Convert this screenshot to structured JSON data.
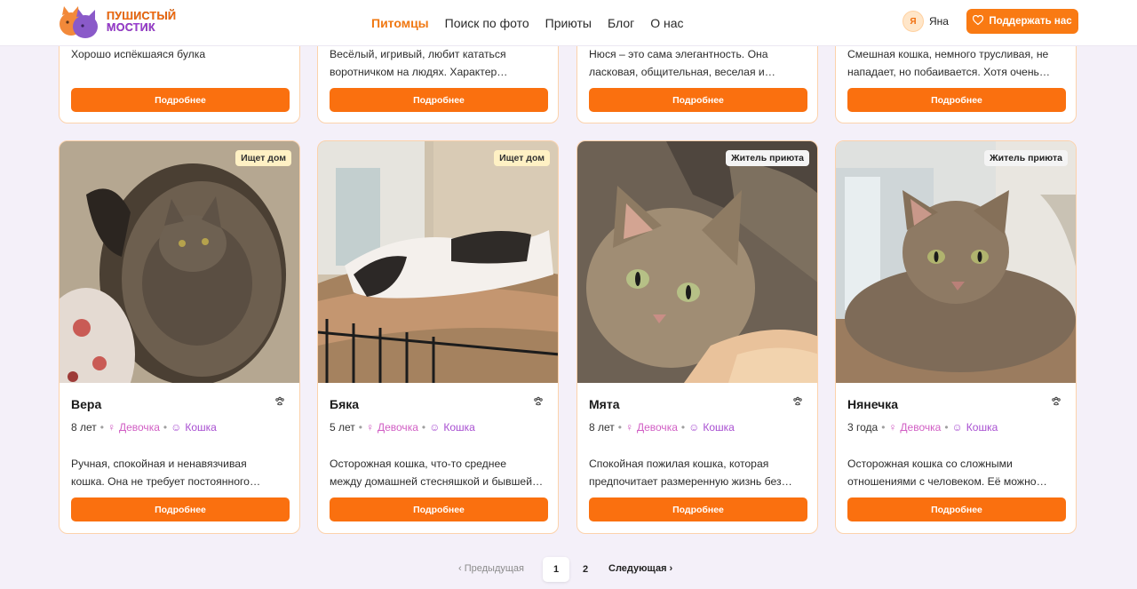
{
  "header": {
    "logo_line1": "ПУШИСТЫЙ",
    "logo_line2": "МОСТИК",
    "nav": [
      "Питомцы",
      "Поиск по фото",
      "Приюты",
      "Блог",
      "О нас"
    ],
    "user_initial": "Я",
    "user_name": "Яна",
    "donate_label": "Поддержать нас"
  },
  "top_cards": [
    {
      "desc1": "Хорошо испёкшаяся булка",
      "desc2": "",
      "button": "Подробнее"
    },
    {
      "desc1": "Весёлый, игривый, любит кататься",
      "desc2": "воротничком на людях. Характер…",
      "button": "Подробнее"
    },
    {
      "desc1": "Нюся – это сама элегантность. Она",
      "desc2": "ласковая, общительная, веселая и…",
      "button": "Подробнее"
    },
    {
      "desc1": "Смешная кошка, немного трусливая, не",
      "desc2": "нападает, но побаивается. Хотя очень…",
      "button": "Подробнее"
    }
  ],
  "cards": [
    {
      "badge": "Ищет дом",
      "name": "Вера",
      "age": "8 лет",
      "gender": "Девочка",
      "kind": "Кошка",
      "desc1": "Ручная, спокойная и ненавязчивая",
      "desc2": "кошка. Она не требует постоянного…",
      "button": "Подробнее"
    },
    {
      "badge": "Ищет дом",
      "name": "Бяка",
      "age": "5 лет",
      "gender": "Девочка",
      "kind": "Кошка",
      "desc1": "Осторожная кошка, что-то среднее",
      "desc2": "между домашней стесняшкой и бывшей…",
      "button": "Подробнее"
    },
    {
      "badge": "Житель приюта",
      "name": "Мята",
      "age": "8 лет",
      "gender": "Девочка",
      "kind": "Кошка",
      "desc1": "Спокойная пожилая кошка, которая",
      "desc2": "предпочитает размеренную жизнь без…",
      "button": "Подробнее"
    },
    {
      "badge": "Житель приюта",
      "name": "Нянечка",
      "age": "3 года",
      "gender": "Девочка",
      "kind": "Кошка",
      "desc1": "Осторожная кошка со сложными",
      "desc2": "отношениями с человеком. Её можно…",
      "button": "Подробнее"
    }
  ],
  "pagination": {
    "prev": "Предыдущая",
    "pages": [
      "1",
      "2"
    ],
    "next": "Следующая"
  },
  "icons": {
    "paw": "paw-icon",
    "heart": "heart-icon",
    "gender": "female-pin-icon",
    "cat": "cat-icon"
  },
  "colors": {
    "accent": "#fa700f",
    "badge_search": "#fff1c4",
    "gender": "#d15ec4",
    "kind": "#a84fd1"
  }
}
